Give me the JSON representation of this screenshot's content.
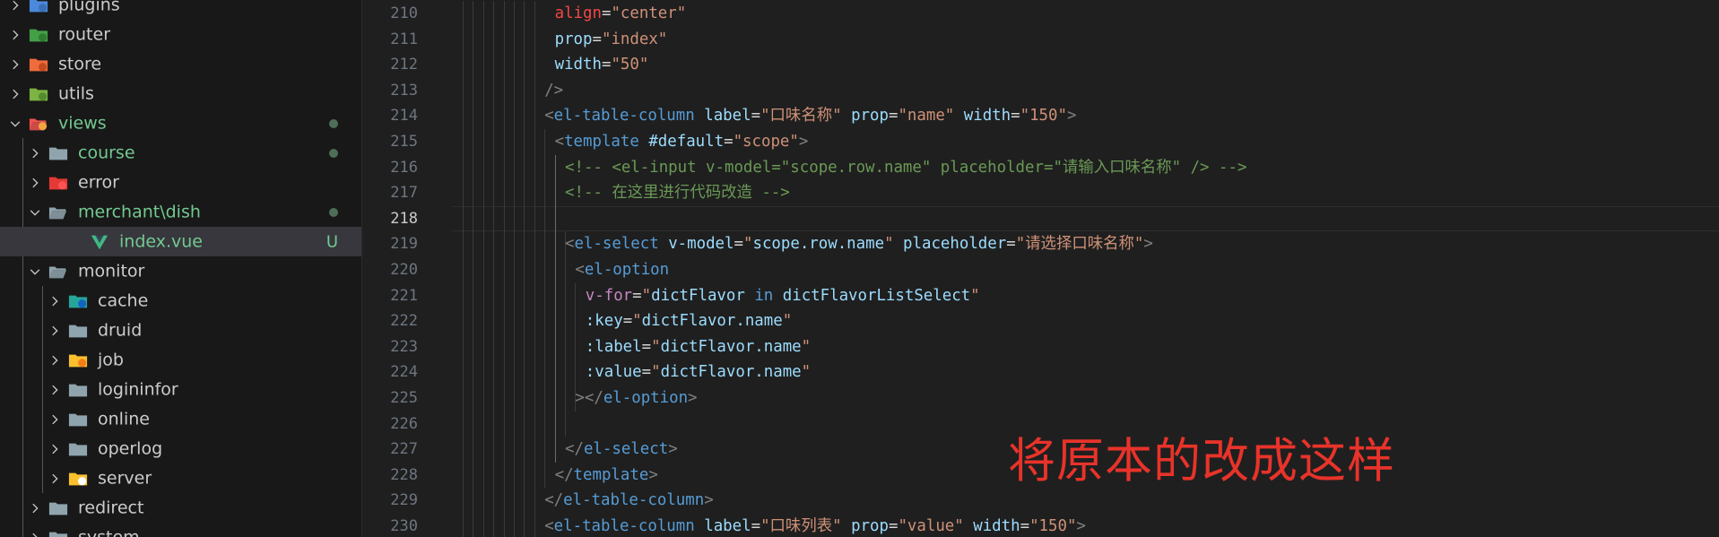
{
  "explorer": {
    "items": [
      {
        "label": "plugins",
        "modified": false,
        "selected": false,
        "badge": "",
        "dot": false,
        "icon": "plugins-folder-icon"
      },
      {
        "label": "router",
        "modified": false,
        "selected": false,
        "badge": "",
        "dot": false,
        "icon": "router-folder-icon"
      },
      {
        "label": "store",
        "modified": false,
        "selected": false,
        "badge": "",
        "dot": false,
        "icon": "store-folder-icon"
      },
      {
        "label": "utils",
        "modified": false,
        "selected": false,
        "badge": "",
        "dot": false,
        "icon": "utils-folder-icon"
      },
      {
        "label": "views",
        "modified": true,
        "selected": false,
        "badge": "",
        "dot": true,
        "icon": "views-folder-icon"
      },
      {
        "label": "course",
        "modified": true,
        "selected": false,
        "badge": "",
        "dot": true,
        "icon": "folder-icon"
      },
      {
        "label": "error",
        "modified": false,
        "selected": false,
        "badge": "",
        "dot": false,
        "icon": "error-folder-icon"
      },
      {
        "label": "merchant\\dish",
        "modified": true,
        "selected": false,
        "badge": "",
        "dot": true,
        "icon": "open-folder-icon"
      },
      {
        "label": "index.vue",
        "modified": true,
        "selected": true,
        "badge": "U",
        "dot": false,
        "icon": "vue-file-icon"
      },
      {
        "label": "monitor",
        "modified": false,
        "selected": false,
        "badge": "",
        "dot": false,
        "icon": "open-folder-icon"
      },
      {
        "label": "cache",
        "modified": false,
        "selected": false,
        "badge": "",
        "dot": false,
        "icon": "cache-folder-icon"
      },
      {
        "label": "druid",
        "modified": false,
        "selected": false,
        "badge": "",
        "dot": false,
        "icon": "folder-icon"
      },
      {
        "label": "job",
        "modified": false,
        "selected": false,
        "badge": "",
        "dot": false,
        "icon": "job-folder-icon"
      },
      {
        "label": "logininfor",
        "modified": false,
        "selected": false,
        "badge": "",
        "dot": false,
        "icon": "folder-icon"
      },
      {
        "label": "online",
        "modified": false,
        "selected": false,
        "badge": "",
        "dot": false,
        "icon": "folder-icon"
      },
      {
        "label": "operlog",
        "modified": false,
        "selected": false,
        "badge": "",
        "dot": false,
        "icon": "folder-icon"
      },
      {
        "label": "server",
        "modified": false,
        "selected": false,
        "badge": "",
        "dot": false,
        "icon": "server-folder-icon"
      },
      {
        "label": "redirect",
        "modified": false,
        "selected": false,
        "badge": "",
        "dot": false,
        "icon": "folder-icon"
      },
      {
        "label": "system",
        "modified": false,
        "selected": false,
        "badge": "",
        "dot": false,
        "icon": "folder-icon"
      }
    ]
  },
  "editor": {
    "current_line": 218,
    "lines": [
      {
        "num": "210",
        "tokens": [
          [
            "t-red",
            "align"
          ],
          [
            "t-plain",
            "="
          ],
          [
            "t-str",
            "\"center\""
          ]
        ]
      },
      {
        "num": "211",
        "tokens": [
          [
            "t-attr",
            "prop"
          ],
          [
            "t-plain",
            "="
          ],
          [
            "t-str",
            "\"index\""
          ]
        ]
      },
      {
        "num": "212",
        "tokens": [
          [
            "t-attr",
            "width"
          ],
          [
            "t-plain",
            "="
          ],
          [
            "t-str",
            "\"50\""
          ]
        ]
      },
      {
        "num": "213",
        "tokens": [
          [
            "t-punc",
            "/>"
          ]
        ]
      },
      {
        "num": "214",
        "tokens": [
          [
            "t-punc",
            "<"
          ],
          [
            "t-tag",
            "el-table-column"
          ],
          [
            "t-plain",
            " "
          ],
          [
            "t-attr",
            "label"
          ],
          [
            "t-plain",
            "="
          ],
          [
            "t-str",
            "\"口味名称\""
          ],
          [
            "t-plain",
            " "
          ],
          [
            "t-attr",
            "prop"
          ],
          [
            "t-plain",
            "="
          ],
          [
            "t-str",
            "\"name\""
          ],
          [
            "t-plain",
            " "
          ],
          [
            "t-attr",
            "width"
          ],
          [
            "t-plain",
            "="
          ],
          [
            "t-str",
            "\"150\""
          ],
          [
            "t-punc",
            ">"
          ]
        ]
      },
      {
        "num": "215",
        "tokens": [
          [
            "t-punc",
            "<"
          ],
          [
            "t-tag",
            "template"
          ],
          [
            "t-plain",
            " "
          ],
          [
            "t-attr",
            "#default"
          ],
          [
            "t-plain",
            "="
          ],
          [
            "t-str",
            "\"scope\""
          ],
          [
            "t-punc",
            ">"
          ]
        ]
      },
      {
        "num": "216",
        "tokens": [
          [
            "t-com",
            "<!-- <el-input v-model=\"scope.row.name\" placeholder=\"请输入口味名称\" /> -->"
          ]
        ]
      },
      {
        "num": "217",
        "tokens": [
          [
            "t-com",
            "<!-- 在这里进行代码改造 -->"
          ]
        ]
      },
      {
        "num": "218",
        "tokens": []
      },
      {
        "num": "219",
        "tokens": [
          [
            "t-punc",
            "<"
          ],
          [
            "t-tag",
            "el-select"
          ],
          [
            "t-plain",
            " "
          ],
          [
            "t-attr",
            "v-model"
          ],
          [
            "t-plain",
            "="
          ],
          [
            "t-str",
            "\""
          ],
          [
            "t-attr",
            "scope.row.name"
          ],
          [
            "t-str",
            "\""
          ],
          [
            "t-plain",
            " "
          ],
          [
            "t-attr",
            "placeholder"
          ],
          [
            "t-plain",
            "="
          ],
          [
            "t-str",
            "\"请选择口味名称\""
          ],
          [
            "t-punc",
            ">"
          ]
        ]
      },
      {
        "num": "220",
        "tokens": [
          [
            "t-punc",
            "<"
          ],
          [
            "t-tag",
            "el-option"
          ]
        ]
      },
      {
        "num": "221",
        "tokens": [
          [
            "t-dir",
            "v-for"
          ],
          [
            "t-plain",
            "="
          ],
          [
            "t-str",
            "\""
          ],
          [
            "t-attr",
            "dictFlavor"
          ],
          [
            "t-plain",
            " "
          ],
          [
            "t-tag",
            "in"
          ],
          [
            "t-plain",
            " "
          ],
          [
            "t-attr",
            "dictFlavorListSelect"
          ],
          [
            "t-str",
            "\""
          ]
        ]
      },
      {
        "num": "222",
        "tokens": [
          [
            "t-attr",
            ":key"
          ],
          [
            "t-plain",
            "="
          ],
          [
            "t-str",
            "\""
          ],
          [
            "t-attr",
            "dictFlavor.name"
          ],
          [
            "t-str",
            "\""
          ]
        ]
      },
      {
        "num": "223",
        "tokens": [
          [
            "t-attr",
            ":label"
          ],
          [
            "t-plain",
            "="
          ],
          [
            "t-str",
            "\""
          ],
          [
            "t-attr",
            "dictFlavor.name"
          ],
          [
            "t-str",
            "\""
          ]
        ]
      },
      {
        "num": "224",
        "tokens": [
          [
            "t-attr",
            ":value"
          ],
          [
            "t-plain",
            "="
          ],
          [
            "t-str",
            "\""
          ],
          [
            "t-attr",
            "dictFlavor.name"
          ],
          [
            "t-str",
            "\""
          ]
        ]
      },
      {
        "num": "225",
        "tokens": [
          [
            "t-punc",
            "></"
          ],
          [
            "t-tag",
            "el-option"
          ],
          [
            "t-punc",
            ">"
          ]
        ]
      },
      {
        "num": "226",
        "tokens": []
      },
      {
        "num": "227",
        "tokens": [
          [
            "t-punc",
            "</"
          ],
          [
            "t-tag",
            "el-select"
          ],
          [
            "t-punc",
            ">"
          ]
        ]
      },
      {
        "num": "228",
        "tokens": [
          [
            "t-punc",
            "</"
          ],
          [
            "t-tag",
            "template"
          ],
          [
            "t-punc",
            ">"
          ]
        ]
      },
      {
        "num": "229",
        "tokens": [
          [
            "t-punc",
            "</"
          ],
          [
            "t-tag",
            "el-table-column"
          ],
          [
            "t-punc",
            ">"
          ]
        ]
      },
      {
        "num": "230",
        "tokens": [
          [
            "t-punc",
            "<"
          ],
          [
            "t-tag",
            "el-table-column"
          ],
          [
            "t-plain",
            " "
          ],
          [
            "t-attr",
            "label"
          ],
          [
            "t-plain",
            "="
          ],
          [
            "t-str",
            "\"口味列表\""
          ],
          [
            "t-plain",
            " "
          ],
          [
            "t-attr",
            "prop"
          ],
          [
            "t-plain",
            "="
          ],
          [
            "t-str",
            "\"value\""
          ],
          [
            "t-plain",
            " "
          ],
          [
            "t-attr",
            "width"
          ],
          [
            "t-plain",
            "="
          ],
          [
            "t-str",
            "\"150\""
          ],
          [
            "t-punc",
            ">"
          ]
        ]
      }
    ]
  },
  "annotation": {
    "text": "将原本的改成这样",
    "color": "#e8332a"
  },
  "colors": {
    "sidebar_bg": "#181818",
    "editor_bg": "#1f1f1f",
    "modified_text": "#73c991",
    "selected_bg": "#37373d"
  }
}
